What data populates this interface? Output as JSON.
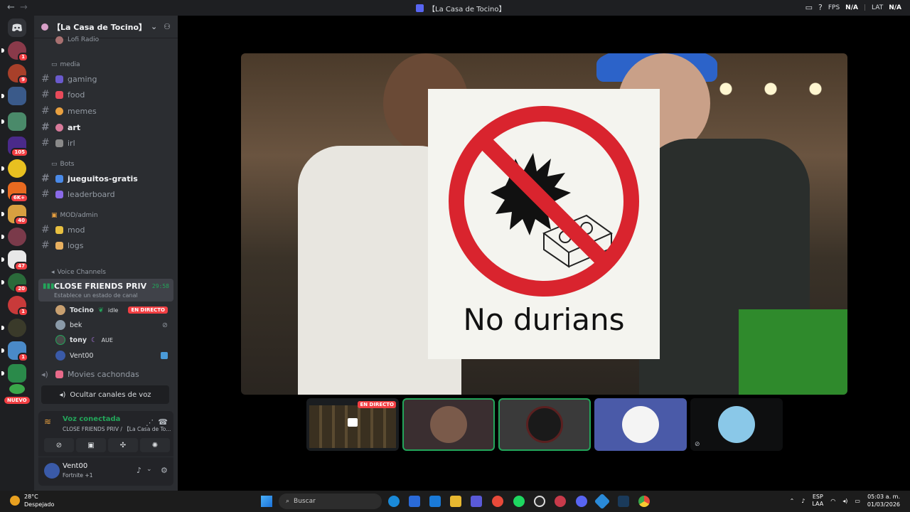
{
  "window": {
    "title": "【La Casa de Tocino】",
    "fps_label": "FPS",
    "fps_value": "N/A",
    "lat_label": "LAT",
    "lat_value": "N/A"
  },
  "rail": {
    "nuevo_label": "NUEVO",
    "badges": [
      "1",
      "9",
      "105",
      "6K+",
      "40",
      "47",
      "20",
      "1",
      "1"
    ]
  },
  "guild": {
    "name": "【La Casa de Tocino】"
  },
  "channels": {
    "lofi": "Lofi Radio",
    "cat_media": "media",
    "gaming": "gaming",
    "food": "food",
    "memes": "memes",
    "art": "art",
    "irl": "irl",
    "cat_bots": "Bots",
    "jueguitos": "jueguitos-gratis",
    "leaderboard": "leaderboard",
    "cat_mod": "MOD/admin",
    "mod": "mod",
    "logs": "logs",
    "cat_voice": "Voice Channels",
    "voice_main": "CLOSE FRIENDS PRIV",
    "voice_timer": "29:58",
    "voice_status": "Establece un estado de canal",
    "movies": "Movies cachondas",
    "hide_voice": "Ocultar canales de voz"
  },
  "members": [
    {
      "name": "Tocino",
      "status": "idle",
      "live": "EN DIRECTO"
    },
    {
      "name": "bek"
    },
    {
      "name": "tony",
      "status": "AUE"
    },
    {
      "name": "Vent00"
    }
  ],
  "voice_panel": {
    "connected": "Voz conectada",
    "sub": "CLOSE FRIENDS PRIV / 【La Casa de To..."
  },
  "user_panel": {
    "name": "Vent00",
    "game": "Fortnite +1"
  },
  "stream": {
    "sign_text": "No durians",
    "tile_live": "EN DIRECTO"
  },
  "taskbar": {
    "temp": "28°C",
    "weather": "Despejado",
    "search": "Buscar",
    "lang1": "ESP",
    "lang2": "LAA",
    "time": "05:03 a. m.",
    "date": "01/03/2026"
  },
  "colors": {
    "accent_green": "#23a55a",
    "live_red": "#f23f43",
    "blurple": "#5865f2"
  }
}
